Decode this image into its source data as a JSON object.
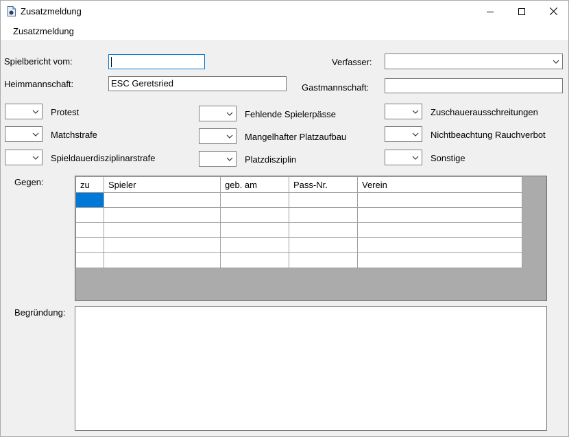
{
  "window": {
    "title": "Zusatzmeldung",
    "icon": "document-app-icon"
  },
  "menu": {
    "items": [
      "Zusatzmeldung"
    ]
  },
  "form": {
    "spielbericht_label": "Spielbericht vom:",
    "spielbericht_value": "",
    "verfasser_label": "Verfasser:",
    "verfasser_value": "",
    "heimmannschaft_label": "Heimmannschaft:",
    "heimmannschaft_value": "ESC Geretsried",
    "gastmannschaft_label": "Gastmannschaft:",
    "gastmannschaft_value": ""
  },
  "options": [
    {
      "label": "Protest"
    },
    {
      "label": "Matchstrafe"
    },
    {
      "label": "Spieldauerdisziplinarstrafe"
    },
    {
      "label": "Fehlende Spielerpässe"
    },
    {
      "label": "Mangelhafter Platzaufbau"
    },
    {
      "label": "Platzdisziplin"
    },
    {
      "label": "Zuschauerausschreitungen"
    },
    {
      "label": "Nichtbeachtung Rauchverbot"
    },
    {
      "label": "Sonstige"
    }
  ],
  "gegen": {
    "label": "Gegen:",
    "columns": [
      "zu",
      "Spieler",
      "geb. am",
      "Pass-Nr.",
      "Verein"
    ],
    "rows": [
      [
        "",
        "",
        "",
        "",
        ""
      ],
      [
        "",
        "",
        "",
        "",
        ""
      ],
      [
        "",
        "",
        "",
        "",
        ""
      ],
      [
        "",
        "",
        "",
        "",
        ""
      ],
      [
        "",
        "",
        "",
        "",
        ""
      ]
    ]
  },
  "begruendung": {
    "label": "Begründung:",
    "value": ""
  }
}
